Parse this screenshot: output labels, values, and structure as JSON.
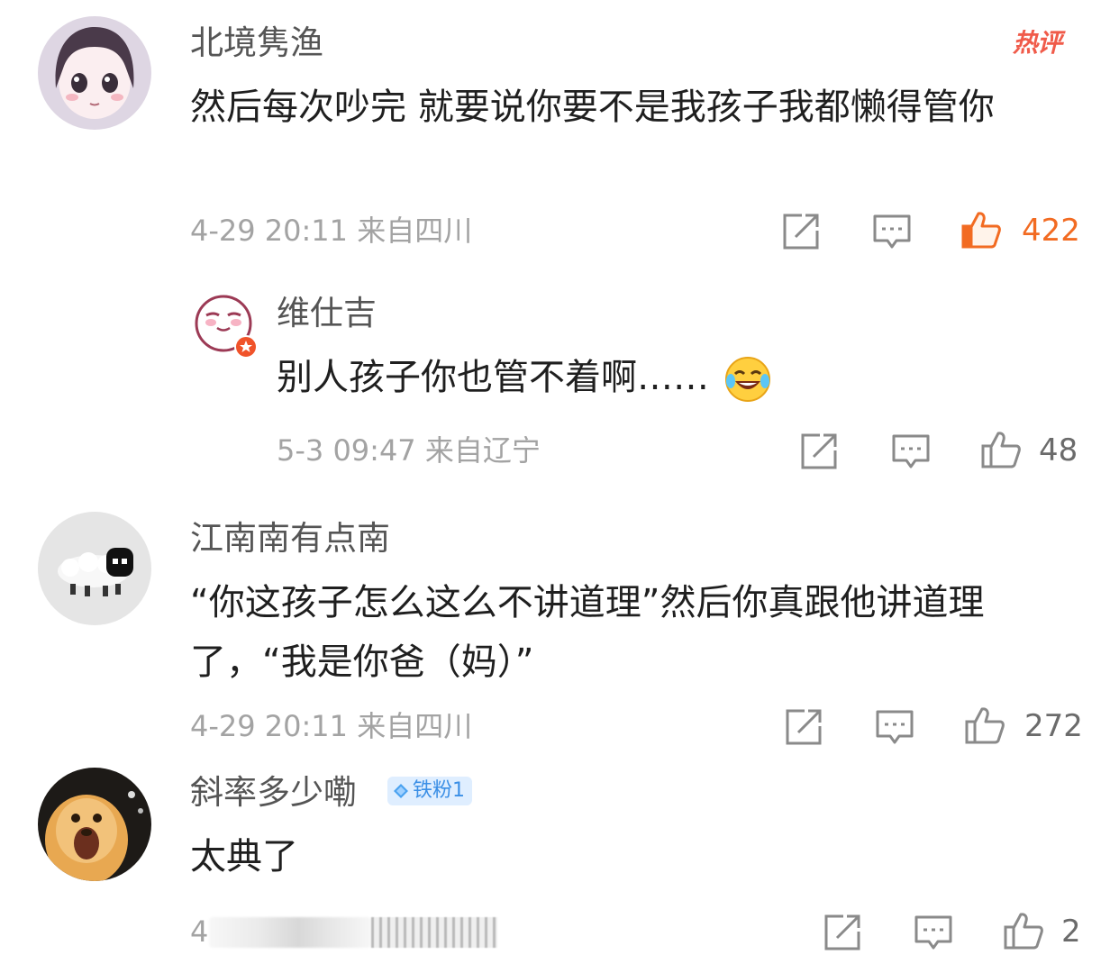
{
  "hot_tag": "热评",
  "comments": [
    {
      "username": "北境隽渔",
      "text": "然后每次吵完 就要说你要不是我孩子我都懒得管你",
      "time": "4-29 20:11",
      "location": "来自四川",
      "likes": "422",
      "liked": true,
      "reply": {
        "username": "维仕吉",
        "text": "别人孩子你也管不着啊……",
        "emoji": "laughing-tears-emoji",
        "time": "5-3 09:47",
        "location": "来自辽宁",
        "likes": "48"
      }
    },
    {
      "username": "江南南有点南",
      "text": "“你这孩子怎么这么不讲道理”然后你真跟他讲道理了，“我是你爸（妈）”",
      "time": "4-29 20:11",
      "location": "来自四川",
      "likes": "272"
    },
    {
      "username": "斜率多少嘞",
      "badge": "铁粉1",
      "text": "太典了",
      "time_partial": "4",
      "likes": "2"
    }
  ],
  "icons": {
    "share": "share-icon",
    "comment": "comment-icon",
    "like": "thumbs-up-icon"
  },
  "colors": {
    "liked_orange": "#f26b22",
    "hot_red": "#f05b4a",
    "badge_blue": "#3b8fe6",
    "meta_gray": "#a3a3a3"
  }
}
